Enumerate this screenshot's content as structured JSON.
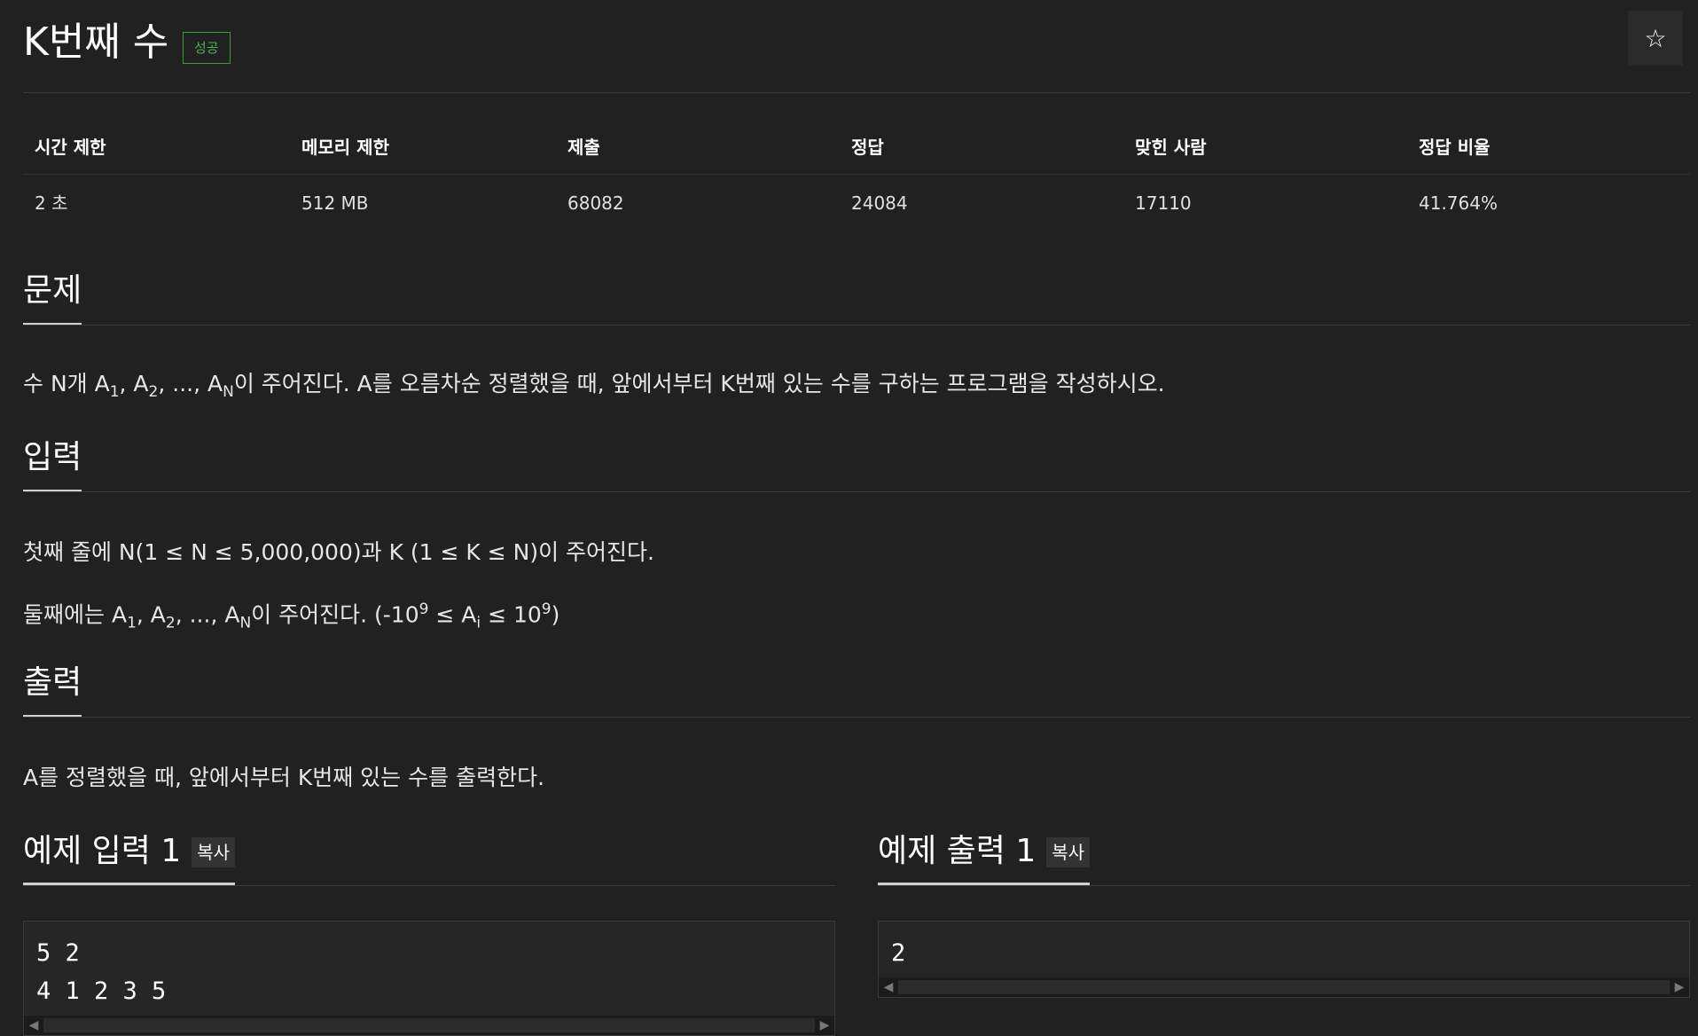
{
  "header": {
    "title": "K번째 수",
    "badge": "성공",
    "star_icon": "☆"
  },
  "info_table": {
    "headers": [
      "시간 제한",
      "메모리 제한",
      "제출",
      "정답",
      "맞힌 사람",
      "정답 비율"
    ],
    "values": [
      "2 초",
      "512 MB",
      "68082",
      "24084",
      "17110",
      "41.764%"
    ]
  },
  "problem": {
    "title": "문제",
    "p1_pre": "수 N개 A",
    "p1_s1": "1",
    "p1_m1": ", A",
    "p1_s2": "2",
    "p1_m2": ", ..., A",
    "p1_sN": "N",
    "p1_post": "이 주어진다. A를 오름차순 정렬했을 때, 앞에서부터 K번째 있는 수를 구하는 프로그램을 작성하시오."
  },
  "input": {
    "title": "입력",
    "line1": "첫째 줄에 N(1 ≤ N ≤ 5,000,000)과 K (1 ≤ K ≤ N)이 주어진다.",
    "l2_pre": "둘째에는 A",
    "l2_s1": "1",
    "l2_m1": ", A",
    "l2_s2": "2",
    "l2_m2": ", ..., A",
    "l2_sN": "N",
    "l2_m3": "이 주어진다. (-10",
    "l2_sup1": "9",
    "l2_m4": " ≤ A",
    "l2_si": "i",
    "l2_m5": " ≤ 10",
    "l2_sup2": "9",
    "l2_post": ")"
  },
  "output": {
    "title": "출력",
    "line1": "A를 정렬했을 때, 앞에서부터 K번째 있는 수를 출력한다."
  },
  "sample_input": {
    "title": "예제 입력 1",
    "copy_label": "복사",
    "content": "5 2\n4 1 2 3 5"
  },
  "sample_output": {
    "title": "예제 출력 1",
    "copy_label": "복사",
    "content": "2"
  }
}
